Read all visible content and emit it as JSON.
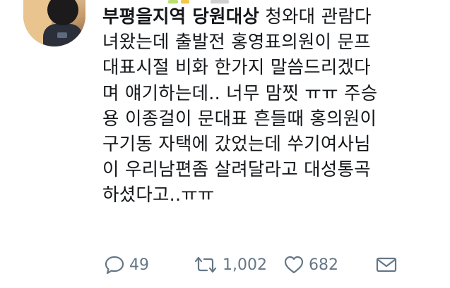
{
  "tweet": {
    "author_name": "부평을지역 당원대상",
    "text_lines": [
      " 청와대 관람다",
      "녀왔는데 출발전 홍영표의원이 문프",
      "대표시절 비화 한가지 말씀드리겠다",
      "며 얘기하는데.. 너무 맘찟 ㅠㅠ 주승",
      "용 이종걸이 문대표 흔들때 홍의원이",
      "구기동 자택에 갔었는데 쑤기여사님",
      "이 우리남편좀 살려달라고 대성통곡",
      "하셨다고..ㅠㅠ"
    ]
  },
  "actions": {
    "reply": {
      "icon": "reply-icon",
      "count": "49"
    },
    "retweet": {
      "icon": "retweet-icon",
      "count": "1,002"
    },
    "like": {
      "icon": "heart-icon",
      "count": "682"
    },
    "message": {
      "icon": "envelope-icon"
    }
  },
  "colors": {
    "text": "#14171a",
    "action_gray": "#657786"
  }
}
